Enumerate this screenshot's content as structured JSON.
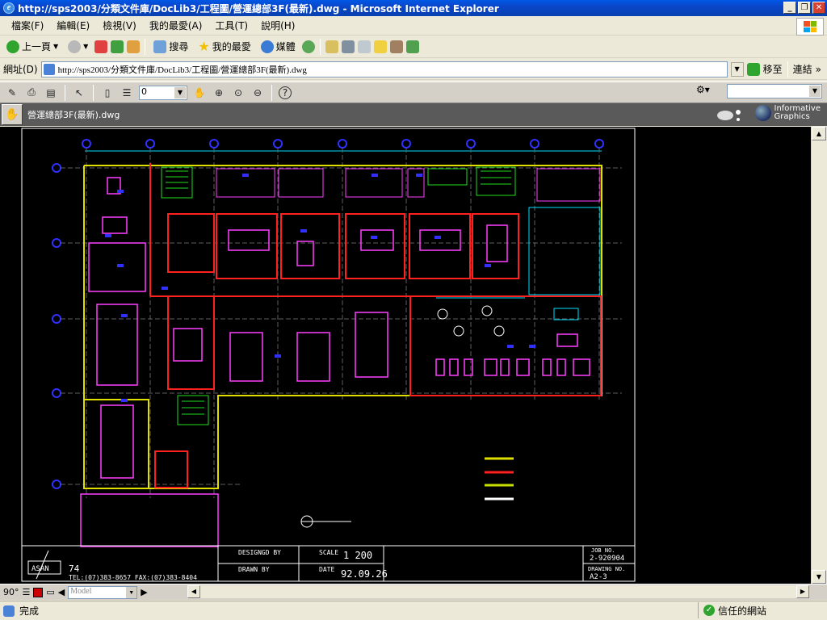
{
  "window": {
    "title": "http://sps2003/分類文件庫/DocLib3/工程圖/營運總部3F(最新).dwg - Microsoft Internet Explorer"
  },
  "menu": {
    "items": [
      "檔案(F)",
      "編輯(E)",
      "檢視(V)",
      "我的最愛(A)",
      "工具(T)",
      "說明(H)"
    ]
  },
  "toolbar": {
    "back": "上一頁",
    "search": "搜尋",
    "favorites": "我的最愛",
    "media": "媒體"
  },
  "address": {
    "label": "網址(D)",
    "url": "http://sps2003/分類文件庫/DocLib3/工程圖/營運總部3F(最新).dwg",
    "go": "移至",
    "links": "連結",
    "more": "»"
  },
  "viewer": {
    "layer_value": "0",
    "doc_name": "營運總部3F(最新).dwg",
    "brand_line1": "Informative",
    "brand_line2": "Graphics",
    "angle": "90°",
    "layout_tab": "Model"
  },
  "drawing": {
    "scale": "1 200",
    "date": "92.09.26",
    "job_no": "2-920904",
    "drawing_no": "A2-3",
    "labels": {
      "designed_by": "DESIGNGD BY",
      "drawn_by": "DRAWN BY",
      "scale": "SCALE",
      "date": "DATE",
      "job_no": "JOB NO.",
      "drawing_no": "DRAWING NO."
    },
    "company_code": "74",
    "company_contact": "TEL:(07)383-8657 FAX:(07)383-8404"
  },
  "status": {
    "text": "完成",
    "zone": "信任的網站"
  },
  "colors": {
    "titlebar": "#0a46c8",
    "canvas": "#000000",
    "wall_red": "#ff2020",
    "furniture_magenta": "#ff40ff",
    "grid_yellow": "#e0e000",
    "dim_cyan": "#00e0ff",
    "label_blue": "#3030ff",
    "green": "#20e020"
  }
}
